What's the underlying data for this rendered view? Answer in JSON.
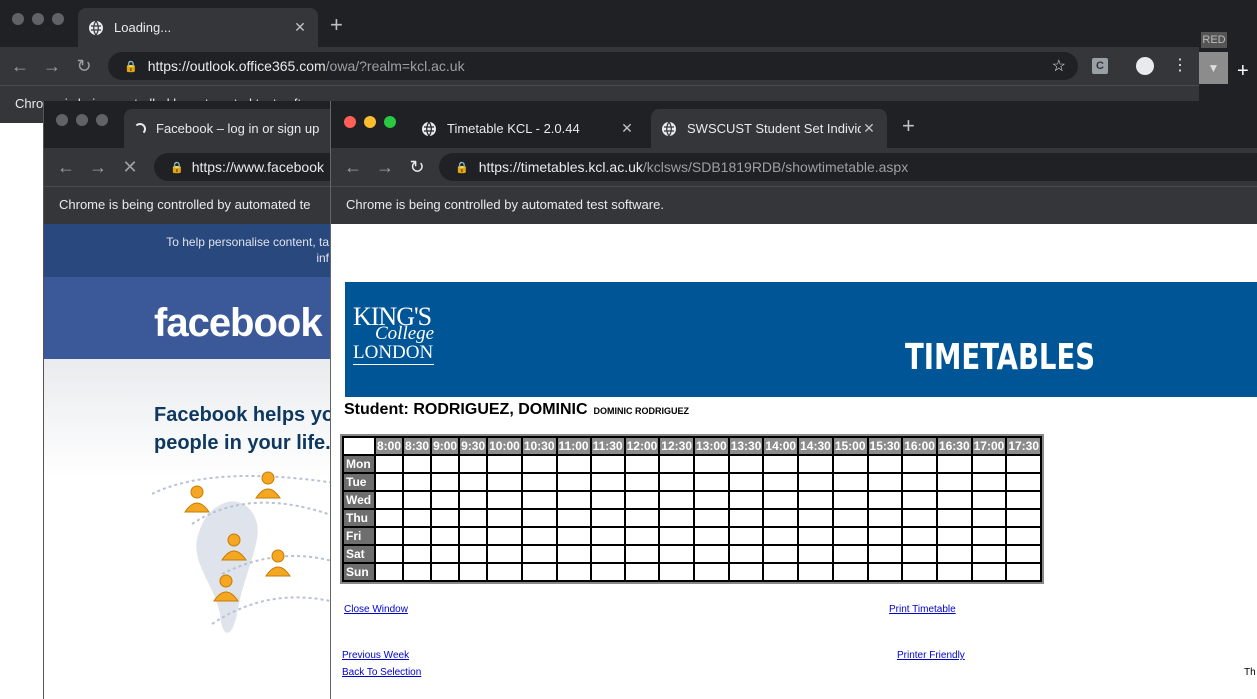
{
  "win_back": {
    "tab_title": "Loading...",
    "url_host": "https://outlook.office365.com",
    "url_path": "/owa/?realm=kcl.ac.uk",
    "infobar": "Chrome is being controlled by automated test software",
    "ext_label": "C",
    "peek_tag": "RED"
  },
  "win_fb": {
    "tab_title": "Facebook – log in or sign up",
    "url": "https://www.facebook",
    "infobar": "Chrome is being controlled by automated te",
    "cookie_line1": "To help personalise content, ta",
    "cookie_line2": "inf",
    "logo": "facebook",
    "headline_1": "Facebook helps yo",
    "headline_2": "people in your life."
  },
  "win_tt": {
    "tabs": [
      {
        "label": "Timetable KCL - 2.0.44"
      },
      {
        "label": "SWSCUST Student Set Individu"
      }
    ],
    "url_host": "https://timetables.kcl.ac.uk",
    "url_path": "/kclsws/SDB1819RDB/showtimetable.aspx",
    "infobar": "Chrome is being controlled by automated test software.",
    "logo_line1": "KING'S",
    "logo_line2": "College",
    "logo_line3": "LONDON",
    "banner_title": "TIMETABLES",
    "student_label": "Student: RODRIGUEZ, DOMINIC",
    "student_name_small": "DOMINIC RODRIGUEZ",
    "times": [
      "8:00",
      "8:30",
      "9:00",
      "9:30",
      "10:00",
      "10:30",
      "11:00",
      "11:30",
      "12:00",
      "12:30",
      "13:00",
      "13:30",
      "14:00",
      "14:30",
      "15:00",
      "15:30",
      "16:00",
      "16:30",
      "17:00",
      "17:30"
    ],
    "days": [
      "Mon",
      "Tue",
      "Wed",
      "Thu",
      "Fri",
      "Sat",
      "Sun"
    ],
    "links": {
      "close_window": "Close Window",
      "print_timetable": "Print Timetable",
      "previous_week": "Previous Week",
      "printer_friendly": "Printer Friendly",
      "back_to_selection": "Back To Selection",
      "cutoff": "Th"
    }
  },
  "colors": {
    "kcl_blue": "#005596",
    "fb_blue": "#3b5998",
    "chrome_dark": "#202124",
    "chrome_toolbar": "#35363a"
  }
}
